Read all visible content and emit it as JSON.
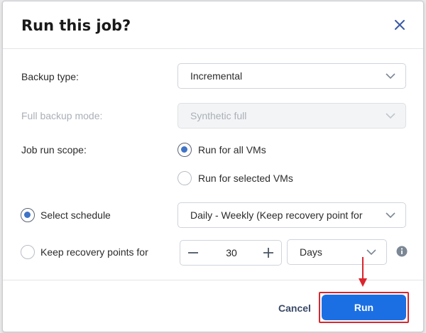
{
  "dialog": {
    "title": "Run this job?"
  },
  "form": {
    "backup_type": {
      "label": "Backup type:",
      "value": "Incremental"
    },
    "full_backup_mode": {
      "label": "Full backup mode:",
      "value": "Synthetic full",
      "disabled": true
    },
    "job_run_scope": {
      "label": "Job run scope:",
      "options": [
        {
          "label": "Run for all VMs",
          "selected": true
        },
        {
          "label": "Run for selected VMs",
          "selected": false
        }
      ]
    },
    "select_schedule": {
      "label": "Select schedule",
      "selected": true,
      "value": "Daily - Weekly (Keep recovery point for"
    },
    "keep_recovery": {
      "label": "Keep recovery points for",
      "selected": false,
      "count": "30",
      "unit": "Days"
    }
  },
  "footer": {
    "cancel_label": "Cancel",
    "run_label": "Run"
  },
  "colors": {
    "primary": "#1b6fe3",
    "radio_dot": "#3f74c6",
    "highlight": "#d9262e"
  }
}
